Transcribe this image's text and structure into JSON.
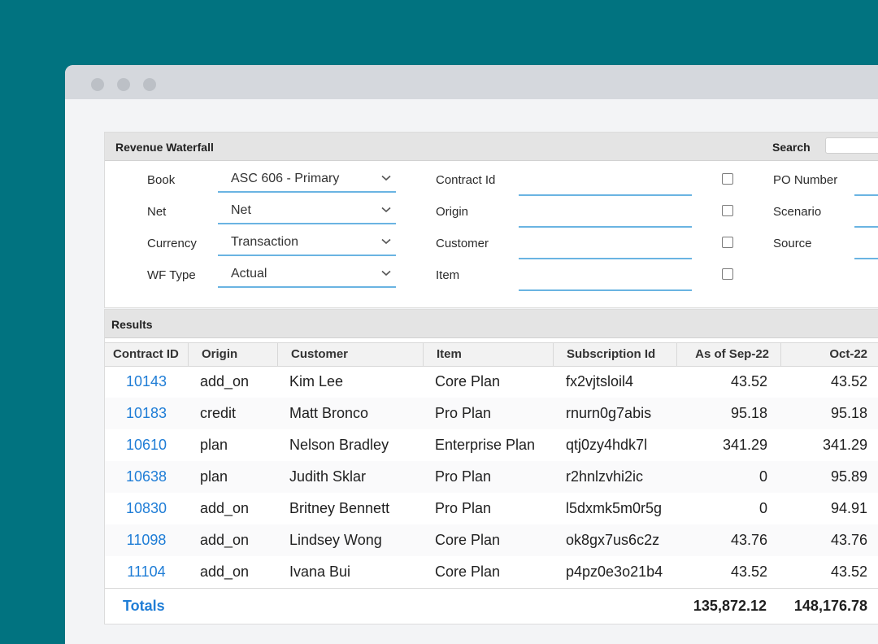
{
  "filters_panel": {
    "title": "Revenue Waterfall",
    "search_label": "Search",
    "search_value": "",
    "selects": [
      {
        "label": "Book",
        "value": "ASC 606 - Primary"
      },
      {
        "label": "Net",
        "value": "Net"
      },
      {
        "label": "Currency",
        "value": "Transaction"
      },
      {
        "label": "WF Type",
        "value": "Actual"
      }
    ],
    "text_fields": [
      {
        "label": "Contract Id",
        "value": ""
      },
      {
        "label": "Origin",
        "value": ""
      },
      {
        "label": "Customer",
        "value": ""
      },
      {
        "label": "Item",
        "value": ""
      }
    ],
    "checkboxes": [
      false,
      false,
      false,
      false
    ],
    "right_fields": [
      {
        "label": "PO Number",
        "value": ""
      },
      {
        "label": "Scenario",
        "value": ""
      },
      {
        "label": "Source",
        "value": ""
      }
    ]
  },
  "results": {
    "title": "Results",
    "columns": [
      "Contract ID",
      "Origin",
      "Customer",
      "Item",
      "Subscription Id",
      "As of Sep-22",
      "Oct-22"
    ],
    "rows": [
      {
        "contract_id": "10143",
        "origin": "add_on",
        "customer": "Kim Lee",
        "item": "Core Plan",
        "subscription_id": "fx2vjtsloil4",
        "as_of_sep22": "43.52",
        "oct22": "43.52"
      },
      {
        "contract_id": "10183",
        "origin": "credit",
        "customer": "Matt Bronco",
        "item": "Pro Plan",
        "subscription_id": "rnurn0g7abis",
        "as_of_sep22": "95.18",
        "oct22": "95.18"
      },
      {
        "contract_id": "10610",
        "origin": "plan",
        "customer": "Nelson Bradley",
        "item": "Enterprise Plan",
        "subscription_id": "qtj0zy4hdk7l",
        "as_of_sep22": "341.29",
        "oct22": "341.29"
      },
      {
        "contract_id": "10638",
        "origin": "plan",
        "customer": "Judith Sklar",
        "item": "Pro Plan",
        "subscription_id": "r2hnlzvhi2ic",
        "as_of_sep22": "0",
        "oct22": "95.89"
      },
      {
        "contract_id": "10830",
        "origin": "add_on",
        "customer": "Britney Bennett",
        "item": "Pro Plan",
        "subscription_id": "l5dxmk5m0r5g",
        "as_of_sep22": "0",
        "oct22": "94.91"
      },
      {
        "contract_id": "11098",
        "origin": "add_on",
        "customer": "Lindsey Wong",
        "item": "Core Plan",
        "subscription_id": "ok8gx7us6c2z",
        "as_of_sep22": "43.76",
        "oct22": "43.76"
      },
      {
        "contract_id": "11104",
        "origin": "add_on",
        "customer": "Ivana Bui",
        "item": "Core Plan",
        "subscription_id": "p4pz0e3o21b4",
        "as_of_sep22": "43.52",
        "oct22": "43.52"
      }
    ],
    "totals": {
      "label": "Totals",
      "as_of_sep22": "135,872.12",
      "oct22": "148,176.78"
    }
  },
  "colors": {
    "background": "#017380",
    "link": "#1f7dd6",
    "field_underline": "#6ab4e2"
  },
  "icons": {
    "window_controls": [
      "window-dot-icon",
      "window-dot-icon",
      "window-dot-icon"
    ],
    "select_arrow": "chevron-down-icon"
  }
}
